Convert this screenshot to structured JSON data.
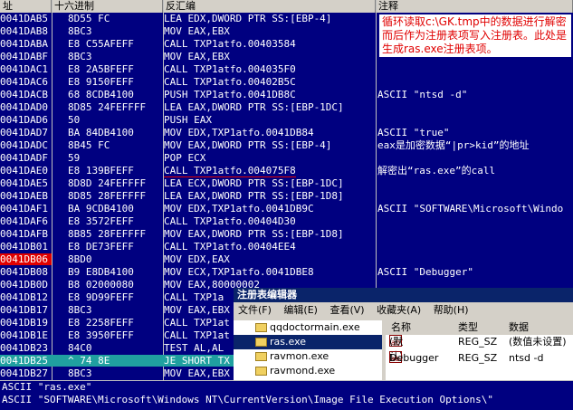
{
  "header": {
    "addr": "址",
    "hex": "十六进制",
    "disasm": "反汇编",
    "comment": "注释"
  },
  "rows": [
    {
      "addr": "0041DAB5",
      "hex": "8D55 FC",
      "dis": "LEA EDX,DWORD PTR SS:[EBP-4]",
      "cmt": ""
    },
    {
      "addr": "0041DAB8",
      "hex": "8BC3",
      "dis": "MOV EAX,EBX",
      "cmt": ""
    },
    {
      "addr": "0041DABA",
      "hex": "E8 C55AFEFF",
      "dis": "CALL TXP1atfo.00403584",
      "cmt": ""
    },
    {
      "addr": "0041DABF",
      "hex": "8BC3",
      "dis": "MOV EAX,EBX",
      "cmt": ""
    },
    {
      "addr": "0041DAC1",
      "hex": "E8 2A5BFEFF",
      "dis": "CALL TXP1atfo.004035F0",
      "cmt": ""
    },
    {
      "addr": "0041DAC6",
      "hex": "E8 9150FEFF",
      "dis": "CALL TXP1atfo.00402B5C",
      "cmt": ""
    },
    {
      "addr": "0041DACB",
      "hex": "68 8CDB4100",
      "dis": "PUSH TXP1atfo.0041DB8C",
      "cmt": "ASCII \"ntsd -d\""
    },
    {
      "addr": "0041DAD0",
      "hex": "8D85 24FEFFFF",
      "dis": "LEA EAX,DWORD PTR SS:[EBP-1DC]",
      "cmt": ""
    },
    {
      "addr": "0041DAD6",
      "hex": "50",
      "dis": "PUSH EAX",
      "cmt": ""
    },
    {
      "addr": "0041DAD7",
      "hex": "BA 84DB4100",
      "dis": "MOV EDX,TXP1atfo.0041DB84",
      "cmt": "ASCII \"true\""
    },
    {
      "addr": "0041DADC",
      "hex": "8B45 FC",
      "dis": "MOV EAX,DWORD PTR SS:[EBP-4]",
      "cmt": "eax是加密数据“|pr>kid”的地址"
    },
    {
      "addr": "0041DADF",
      "hex": "59",
      "dis": "POP ECX",
      "cmt": ""
    },
    {
      "addr": "0041DAE0",
      "hex": "E8 139BFEFF",
      "dis": "CALL TXP1atfo.004075F8",
      "cmt": "解密出“ras.exe”的call"
    },
    {
      "addr": "0041DAE5",
      "hex": "8D8D 24FEFFFF",
      "dis": "LEA ECX,DWORD PTR SS:[EBP-1DC]",
      "cmt": ""
    },
    {
      "addr": "0041DAEB",
      "hex": "8D85 28FEFFFF",
      "dis": "LEA EAX,DWORD PTR SS:[EBP-1D8]",
      "cmt": ""
    },
    {
      "addr": "0041DAF1",
      "hex": "BA 9CDB4100",
      "dis": "MOV EDX,TXP1atfo.0041DB9C",
      "cmt": "ASCII \"SOFTWARE\\Microsoft\\Windo"
    },
    {
      "addr": "0041DAF6",
      "hex": "E8 3572FEFF",
      "dis": "CALL TXP1atfo.00404D30",
      "cmt": ""
    },
    {
      "addr": "0041DAFB",
      "hex": "8B85 28FEFFFF",
      "dis": "MOV EAX,DWORD PTR SS:[EBP-1D8]",
      "cmt": ""
    },
    {
      "addr": "0041DB01",
      "hex": "E8 DE73FEFF",
      "dis": "CALL TXP1atfo.00404EE4",
      "cmt": ""
    },
    {
      "addr": "0041DB06",
      "hex": "8BD0",
      "dis": "MOV EDX,EAX",
      "cmt": ""
    },
    {
      "addr": "0041DB08",
      "hex": "B9 E8DB4100",
      "dis": "MOV ECX,TXP1atfo.0041DBE8",
      "cmt": "ASCII \"Debugger\""
    },
    {
      "addr": "0041DB0D",
      "hex": "B8 02000080",
      "dis": "MOV EAX,80000002",
      "cmt": ""
    },
    {
      "addr": "0041DB12",
      "hex": "E8 9D99FEFF",
      "dis": "CALL TXP1a",
      "cmt": ""
    },
    {
      "addr": "0041DB17",
      "hex": "8BC3",
      "dis": "MOV EAX,EBX",
      "cmt": ""
    },
    {
      "addr": "0041DB19",
      "hex": "E8 2258FEFF",
      "dis": "CALL TXP1at",
      "cmt": ""
    },
    {
      "addr": "0041DB1E",
      "hex": "E8 3950FEFF",
      "dis": "CALL TXP1at",
      "cmt": ""
    },
    {
      "addr": "0041DB23",
      "hex": "84C0",
      "dis": "TEST AL,AL",
      "cmt": ""
    },
    {
      "addr": "0041DB25",
      "hex": "^ 74 8E",
      "dis": "JE SHORT TX",
      "cmt": ""
    },
    {
      "addr": "0041DB27",
      "hex": "8BC3",
      "dis": "MOV EAX,EBX",
      "cmt": ""
    }
  ],
  "note": "循环读取c:\\GK.tmp中的数据进行解密而后作为注册表项写入注册表。此处是生成ras.exe注册表项。",
  "regedit": {
    "title": "注册表编辑器",
    "menu": [
      "文件(F)",
      "编辑(E)",
      "查看(V)",
      "收藏夹(A)",
      "帮助(H)"
    ],
    "tree": [
      "qqdoctormain.exe",
      "ras.exe",
      "ravmon.exe",
      "ravmond.exe"
    ],
    "cols": [
      "名称",
      "类型",
      "数据"
    ],
    "values": [
      {
        "name": "(默认)",
        "type": "REG_SZ",
        "data": "(数值未设置)"
      },
      {
        "name": "Debugger",
        "type": "REG_SZ",
        "data": "ntsd -d"
      }
    ]
  },
  "bottom": [
    "ASCII \"ras.exe\"",
    "ASCII \"SOFTWARE\\Microsoft\\Windows NT\\CurrentVersion\\Image File Execution Options\\\""
  ]
}
